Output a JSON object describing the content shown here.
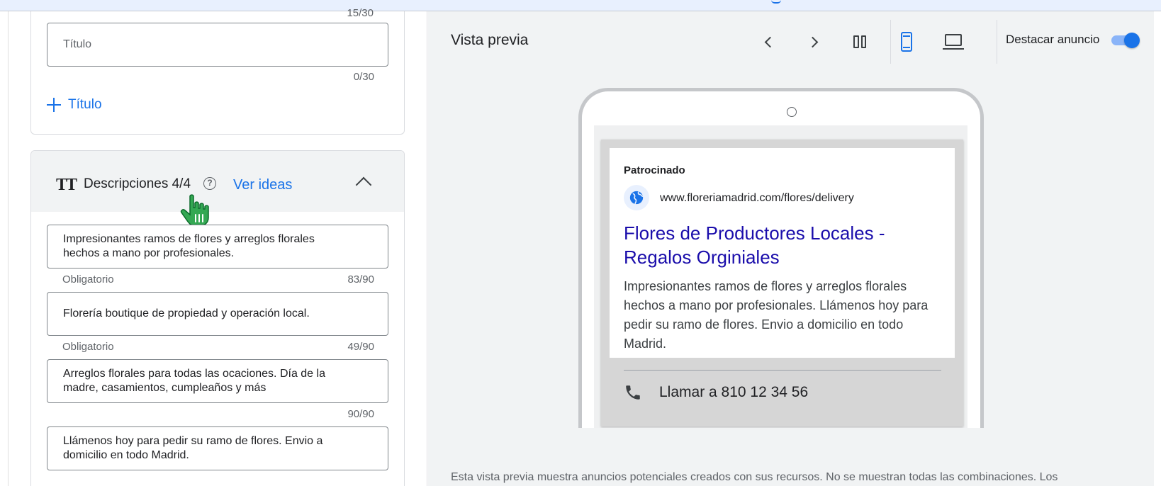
{
  "top_counter": "15/30",
  "title_field": {
    "placeholder": "Título",
    "counter": "0/30"
  },
  "add_title_label": "Título",
  "descriptions": {
    "section_title": "Descripciones 4/4",
    "ver_ideas": "Ver ideas",
    "items": [
      {
        "value": "Impresionantes ramos de flores y arreglos florales hechos a mano por profesionales.",
        "helper": "Obligatorio",
        "counter": "83/90"
      },
      {
        "value": "Florería boutique de propiedad y operación local.",
        "helper": "Obligatorio",
        "counter": "49/90"
      },
      {
        "value": "Arreglos florales para todas las ocaciones. Día de la madre, casamientos, cumpleaños y más",
        "helper": "",
        "counter": "90/90"
      },
      {
        "value": "Llámenos hoy para pedir su ramo de flores. Envio a domicilio en todo Madrid.",
        "helper": "",
        "counter": ""
      }
    ]
  },
  "preview": {
    "title": "Vista previa",
    "destacar_label": "Destacar anuncio",
    "destacar_on": true,
    "accent_color": "#1a73e8",
    "ad": {
      "sponsored": "Patrocinado",
      "url": "www.floreriamadrid.com/flores/delivery",
      "headline": "Flores de Productores Locales - Regalos Orginiales",
      "description": "Impresionantes ramos de flores y arreglos florales hechos a mano por profesionales. Llámenos hoy para pedir su ramo de flores. Envio a domicilio en todo Madrid.",
      "call": "Llamar a 810 12 34 56"
    },
    "footnote": "Esta vista previa muestra anuncios potenciales creados con sus recursos. No se muestran todas las combinaciones. Los"
  }
}
